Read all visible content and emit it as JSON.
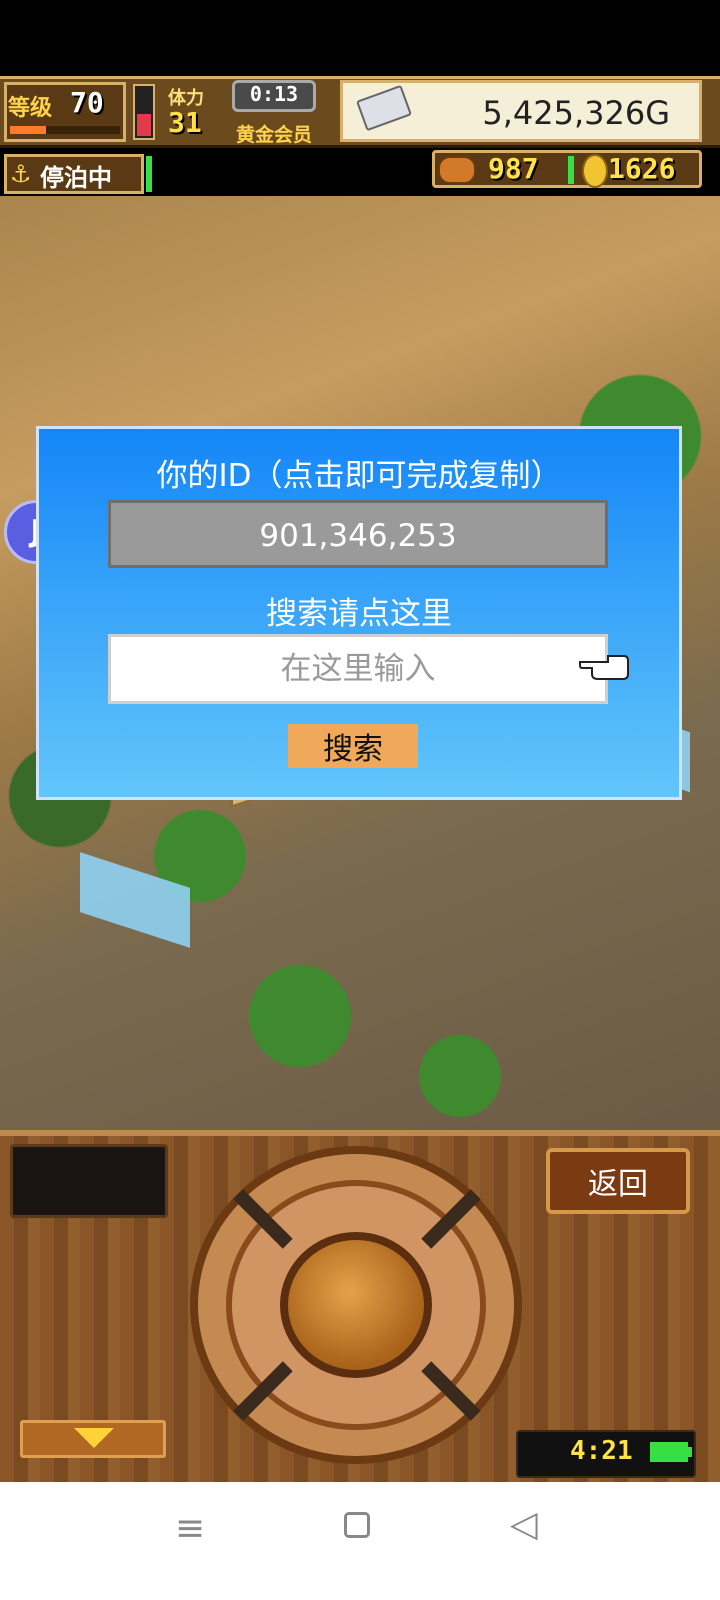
{
  "hud": {
    "level_label": "等级",
    "level_value": "70",
    "stamina_label": "体力",
    "stamina_value": "31",
    "timer": "0:13",
    "member_label": "黄金会员",
    "money": "5,425,326G",
    "dock_status": "停泊中",
    "food_count": "987",
    "coin_count": "1626"
  },
  "float_button": {
    "label": "J"
  },
  "dialog": {
    "id_title": "你的ID（点击即可完成复制）",
    "id_value": "901,346,253",
    "search_hint": "搜索请点这里",
    "search_placeholder": "在这里输入",
    "search_button": "搜索"
  },
  "panel": {
    "back_button": "返回",
    "clock": "4:21"
  },
  "navbar": {
    "menu_icon": "≡",
    "back_icon": "◁"
  }
}
